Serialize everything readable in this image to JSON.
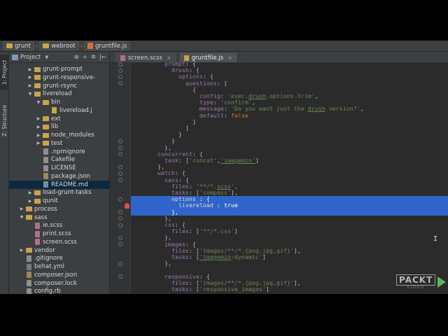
{
  "breadcrumb": [
    "grunt",
    "webroot",
    "gruntfile.js"
  ],
  "toolwindows": [
    "1: Project",
    "Z: Structure"
  ],
  "project": {
    "title": "Project",
    "tools": [
      "⊕",
      "÷",
      "✲",
      "|←"
    ],
    "tree": [
      {
        "name": "grunt-prompt",
        "depth": 3,
        "type": "folder",
        "state": "collapsed"
      },
      {
        "name": "grunt-responsive-",
        "depth": 3,
        "type": "folder",
        "state": "collapsed"
      },
      {
        "name": "grunt-rsync",
        "depth": 3,
        "type": "folder",
        "state": "collapsed"
      },
      {
        "name": "livereload",
        "depth": 3,
        "type": "folder",
        "state": "expanded"
      },
      {
        "name": "bin",
        "depth": 4,
        "type": "folder",
        "state": "expanded"
      },
      {
        "name": "livereload.j",
        "depth": 5,
        "type": "file",
        "ext": "js"
      },
      {
        "name": "ext",
        "depth": 4,
        "type": "folder",
        "state": "collapsed"
      },
      {
        "name": "lib",
        "depth": 4,
        "type": "folder",
        "state": "collapsed"
      },
      {
        "name": "node_modules",
        "depth": 4,
        "type": "folder",
        "state": "collapsed"
      },
      {
        "name": "test",
        "depth": 4,
        "type": "folder",
        "state": "collapsed"
      },
      {
        "name": ".npmignore",
        "depth": 4,
        "type": "file",
        "ext": "txt"
      },
      {
        "name": "Cakefile",
        "depth": 4,
        "type": "file",
        "ext": "txt"
      },
      {
        "name": "LICENSE",
        "depth": 4,
        "type": "file",
        "ext": "txt"
      },
      {
        "name": "package.json",
        "depth": 4,
        "type": "file",
        "ext": "json"
      },
      {
        "name": "README.md",
        "depth": 4,
        "type": "file",
        "ext": "md",
        "selected": true
      },
      {
        "name": "load-grunt-tasks",
        "depth": 3,
        "type": "folder",
        "state": "collapsed"
      },
      {
        "name": "qunit",
        "depth": 3,
        "type": "folder",
        "state": "collapsed"
      },
      {
        "name": "process",
        "depth": 2,
        "type": "folder",
        "state": "collapsed"
      },
      {
        "name": "sass",
        "depth": 2,
        "type": "folder",
        "state": "expanded"
      },
      {
        "name": "ie.scss",
        "depth": 3,
        "type": "file",
        "ext": "scss"
      },
      {
        "name": "print.scss",
        "depth": 3,
        "type": "file",
        "ext": "scss"
      },
      {
        "name": "screen.scss",
        "depth": 3,
        "type": "file",
        "ext": "scss"
      },
      {
        "name": "vendor",
        "depth": 2,
        "type": "folder",
        "state": "collapsed"
      },
      {
        "name": ".gitignore",
        "depth": 2,
        "type": "file",
        "ext": "txt"
      },
      {
        "name": "behat.yml",
        "depth": 2,
        "type": "file",
        "ext": "yml"
      },
      {
        "name": "composer.json",
        "depth": 2,
        "type": "file",
        "ext": "json"
      },
      {
        "name": "composer.lock",
        "depth": 2,
        "type": "file",
        "ext": "txt"
      },
      {
        "name": "config.rb",
        "depth": 2,
        "type": "file",
        "ext": "txt"
      }
    ]
  },
  "tabs": [
    {
      "label": "screen.scss",
      "close": "×",
      "active": false
    },
    {
      "label": "gruntfile.js",
      "close": "×",
      "active": true
    }
  ],
  "code": [
    {
      "indent": 4,
      "parts": [
        [
          "k",
          "prompt"
        ],
        [
          "p",
          ": {"
        ]
      ]
    },
    {
      "indent": 5,
      "parts": [
        [
          "k",
          "drush"
        ],
        [
          "p",
          ": {"
        ]
      ]
    },
    {
      "indent": 6,
      "parts": [
        [
          "k",
          "options"
        ],
        [
          "p",
          ": {"
        ]
      ]
    },
    {
      "indent": 7,
      "parts": [
        [
          "k",
          "questions"
        ],
        [
          "p",
          ": ["
        ]
      ]
    },
    {
      "indent": 8,
      "parts": [
        [
          "p",
          "{"
        ]
      ]
    },
    {
      "indent": 9,
      "parts": [
        [
          "k",
          "config"
        ],
        [
          "p",
          ": "
        ],
        [
          "s",
          "'exec."
        ],
        [
          "su",
          "drush"
        ],
        [
          "s",
          ".options.trim'"
        ],
        [
          "p",
          ","
        ]
      ]
    },
    {
      "indent": 9,
      "parts": [
        [
          "k",
          "type"
        ],
        [
          "p",
          ": "
        ],
        [
          "s",
          "'confirm'"
        ],
        [
          "p",
          ","
        ]
      ]
    },
    {
      "indent": 9,
      "parts": [
        [
          "k",
          "message"
        ],
        [
          "p",
          ": "
        ],
        [
          "s",
          "'Do you want just the "
        ],
        [
          "su",
          "drush"
        ],
        [
          "s",
          " version?'"
        ],
        [
          "p",
          ","
        ]
      ]
    },
    {
      "indent": 9,
      "parts": [
        [
          "k",
          "default"
        ],
        [
          "p",
          ": "
        ],
        [
          "b",
          "false"
        ]
      ]
    },
    {
      "indent": 8,
      "parts": [
        [
          "p",
          "}"
        ]
      ]
    },
    {
      "indent": 7,
      "parts": [
        [
          "p",
          "]"
        ]
      ]
    },
    {
      "indent": 6,
      "parts": [
        [
          "p",
          "}"
        ]
      ]
    },
    {
      "indent": 5,
      "parts": [
        [
          "p",
          "}"
        ]
      ]
    },
    {
      "indent": 4,
      "parts": [
        [
          "p",
          "},"
        ]
      ]
    },
    {
      "indent": 3,
      "parts": [
        [
          "k",
          "concurrent"
        ],
        [
          "p",
          ": {"
        ]
      ]
    },
    {
      "indent": 4,
      "parts": [
        [
          "k",
          "task"
        ],
        [
          "p",
          ": ["
        ],
        [
          "s",
          "'concat'"
        ],
        [
          "p",
          ","
        ],
        [
          "su",
          "'imagemin'"
        ],
        [
          "p",
          "]"
        ]
      ]
    },
    {
      "indent": 3,
      "parts": [
        [
          "p",
          "},"
        ]
      ]
    },
    {
      "indent": 3,
      "parts": [
        [
          "k",
          "watch"
        ],
        [
          "p",
          ": {"
        ]
      ]
    },
    {
      "indent": 4,
      "parts": [
        [
          "k",
          "sass"
        ],
        [
          "p",
          ": {"
        ]
      ]
    },
    {
      "indent": 5,
      "parts": [
        [
          "k",
          "files"
        ],
        [
          "p",
          ": "
        ],
        [
          "s",
          "'**/*."
        ],
        [
          "su",
          "scss"
        ],
        [
          "s",
          "'"
        ],
        [
          "p",
          ","
        ]
      ]
    },
    {
      "indent": 5,
      "parts": [
        [
          "k",
          "tasks"
        ],
        [
          "p",
          ": ["
        ],
        [
          "s",
          "'compass'"
        ],
        [
          "p",
          "],"
        ]
      ]
    },
    {
      "indent": 5,
      "hl": true,
      "parts": [
        [
          "hlk",
          "options"
        ],
        [
          "hls",
          " : {"
        ]
      ]
    },
    {
      "indent": 6,
      "hl": true,
      "parts": [
        [
          "hlk",
          "livereload"
        ],
        [
          "hls",
          " : "
        ],
        [
          "hls",
          "true"
        ]
      ]
    },
    {
      "indent": 5,
      "hl": true,
      "parts": [
        [
          "hls",
          "},"
        ]
      ]
    },
    {
      "indent": 4,
      "parts": [
        [
          "p",
          "},"
        ]
      ]
    },
    {
      "indent": 4,
      "parts": [
        [
          "k",
          "css"
        ],
        [
          "p",
          ": {"
        ]
      ]
    },
    {
      "indent": 5,
      "parts": [
        [
          "k",
          "files"
        ],
        [
          "p",
          ": ["
        ],
        [
          "s",
          "'**/*.css'"
        ],
        [
          "p",
          "]"
        ]
      ]
    },
    {
      "indent": 4,
      "parts": [
        [
          "p",
          "},"
        ]
      ]
    },
    {
      "indent": 4,
      "parts": [
        [
          "k",
          "images"
        ],
        [
          "p",
          ": {"
        ]
      ]
    },
    {
      "indent": 5,
      "parts": [
        [
          "k",
          "files"
        ],
        [
          "p",
          ": ["
        ],
        [
          "s",
          "'images/**/*.{png,jpg,gif}'"
        ],
        [
          "p",
          "],"
        ]
      ]
    },
    {
      "indent": 5,
      "parts": [
        [
          "k",
          "tasks"
        ],
        [
          "p",
          ": ["
        ],
        [
          "su",
          "'imagemin"
        ],
        [
          "s",
          ":dynamic'"
        ],
        [
          "p",
          "]"
        ]
      ]
    },
    {
      "indent": 4,
      "parts": [
        [
          "p",
          "},"
        ]
      ]
    },
    {
      "indent": 0,
      "parts": []
    },
    {
      "indent": 4,
      "parts": [
        [
          "k",
          "responsive"
        ],
        [
          "p",
          ": {"
        ]
      ]
    },
    {
      "indent": 5,
      "parts": [
        [
          "k",
          "files"
        ],
        [
          "p",
          ": ["
        ],
        [
          "s",
          "'images/**/*.{png,jpg,gif}'"
        ],
        [
          "p",
          "],"
        ]
      ]
    },
    {
      "indent": 5,
      "parts": [
        [
          "k",
          "tasks"
        ],
        [
          "p",
          ": ["
        ],
        [
          "s",
          "'responsive_images'"
        ],
        [
          "p",
          "]"
        ]
      ]
    }
  ],
  "watermark": {
    "brand": "PACKT",
    "sub": "VIDEO"
  }
}
